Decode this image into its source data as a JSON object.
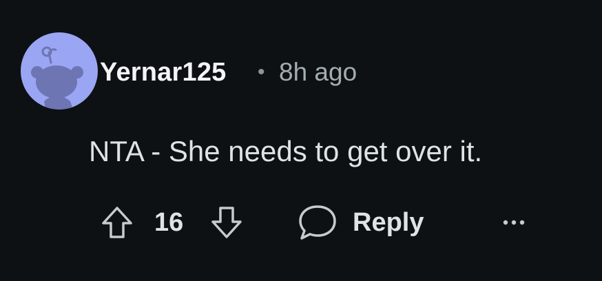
{
  "comment": {
    "author": "Yernar125",
    "separator": "•",
    "time_ago": "8h ago",
    "text": "NTA - She needs to get over it.",
    "avatar_icon": "snoo-avatar-icon",
    "avatar_color": "#9aa6f3"
  },
  "actions": {
    "upvote_icon": "arrow-up-icon",
    "vote_count": "16",
    "downvote_icon": "arrow-down-icon",
    "reply_icon": "speech-bubble-icon",
    "reply_label": "Reply",
    "more_icon": "ellipsis-icon",
    "more_label": "···"
  },
  "colors": {
    "background": "#0e1113",
    "username": "#f2f4f5",
    "meta": "#a3adb2",
    "text": "#dfe3e6",
    "icon": "#c4ccd1"
  }
}
